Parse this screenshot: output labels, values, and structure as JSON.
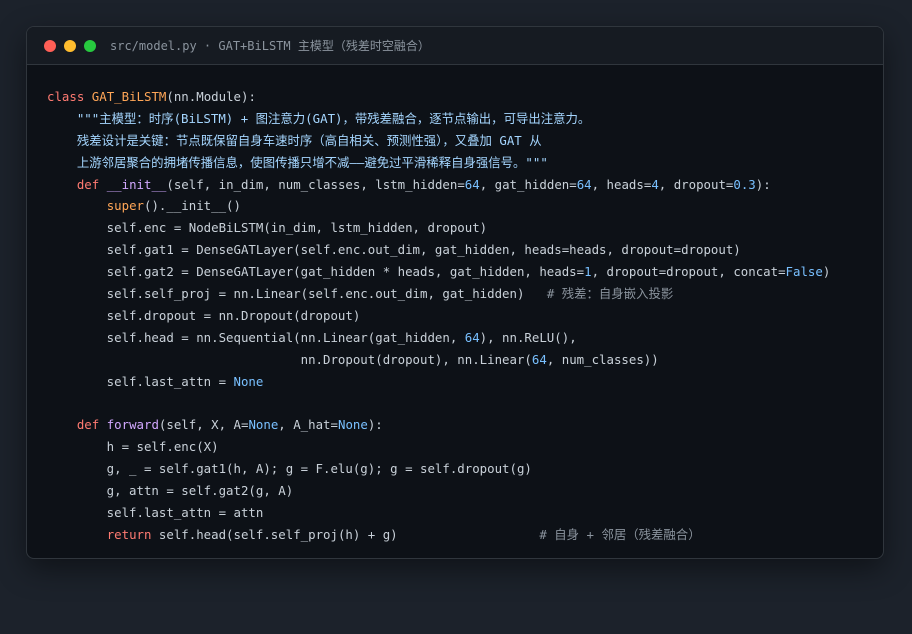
{
  "window": {
    "title": "src/model.py · GAT+BiLSTM 主模型（残差时空融合）",
    "controls": {
      "close": "#ff5f56",
      "minimize": "#ffbd2e",
      "maximize": "#27c93f"
    }
  },
  "colors": {
    "background": "#1c222b",
    "editor": "#0d1117",
    "keyword": "#ff7b72",
    "class_name": "#ffa657",
    "function": "#d2a8ff",
    "string": "#a5d6ff",
    "number": "#79c0ff",
    "comment": "#8b949e"
  },
  "code": {
    "lines": [
      [
        {
          "t": "class",
          "c": "kw"
        },
        {
          "t": " "
        },
        {
          "t": "GAT_BiLSTM",
          "c": "cls"
        },
        {
          "t": "(nn.Module):"
        }
      ],
      [
        {
          "t": "    "
        },
        {
          "t": "\"\"\"主模型：时序(BiLSTM) + 图注意力(GAT)，带残差融合，逐节点输出，可导出注意力。",
          "c": "str"
        }
      ],
      [
        {
          "t": "    残差设计是关键：节点既保留自身车速时序（高自相关、预测性强），又叠加 GAT 从",
          "c": "str"
        }
      ],
      [
        {
          "t": "    上游邻居聚合的拥堵传播信息，使图传播只增不减——避免过平滑稀释自身强信号。\"\"\"",
          "c": "str"
        }
      ],
      [
        {
          "t": "    "
        },
        {
          "t": "def",
          "c": "kw"
        },
        {
          "t": " "
        },
        {
          "t": "__init__",
          "c": "fn"
        },
        {
          "t": "(self, in_dim, num_classes, lstm_hidden="
        },
        {
          "t": "64",
          "c": "num"
        },
        {
          "t": ", gat_hidden="
        },
        {
          "t": "64",
          "c": "num"
        },
        {
          "t": ", heads="
        },
        {
          "t": "4",
          "c": "num"
        },
        {
          "t": ", dropout="
        },
        {
          "t": "0.3",
          "c": "num"
        },
        {
          "t": "):"
        }
      ],
      [
        {
          "t": "        "
        },
        {
          "t": "super",
          "c": "cls"
        },
        {
          "t": "().__init__()"
        }
      ],
      [
        {
          "t": "        self.enc = NodeBiLSTM(in_dim, lstm_hidden, dropout)"
        }
      ],
      [
        {
          "t": "        self.gat1 = DenseGATLayer(self.enc.out_dim, gat_hidden, heads=heads, dropout=dropout)"
        }
      ],
      [
        {
          "t": "        self.gat2 = DenseGATLayer(gat_hidden * heads, gat_hidden, heads="
        },
        {
          "t": "1",
          "c": "num"
        },
        {
          "t": ", dropout=dropout, concat="
        },
        {
          "t": "False",
          "c": "cst"
        },
        {
          "t": ")"
        }
      ],
      [
        {
          "t": "        self.self_proj = nn.Linear(self.enc.out_dim, gat_hidden)   "
        },
        {
          "t": "# 残差：自身嵌入投影",
          "c": "cmt"
        }
      ],
      [
        {
          "t": "        self.dropout = nn.Dropout(dropout)"
        }
      ],
      [
        {
          "t": "        self.head = nn.Sequential(nn.Linear(gat_hidden, "
        },
        {
          "t": "64",
          "c": "num"
        },
        {
          "t": "), nn.ReLU(),"
        }
      ],
      [
        {
          "t": "                                  nn.Dropout(dropout), nn.Linear("
        },
        {
          "t": "64",
          "c": "num"
        },
        {
          "t": ", num_classes))"
        }
      ],
      [
        {
          "t": "        self.last_attn = "
        },
        {
          "t": "None",
          "c": "cst"
        }
      ],
      [],
      [
        {
          "t": "    "
        },
        {
          "t": "def",
          "c": "kw"
        },
        {
          "t": " "
        },
        {
          "t": "forward",
          "c": "fn"
        },
        {
          "t": "(self, X, A="
        },
        {
          "t": "None",
          "c": "cst"
        },
        {
          "t": ", A_hat="
        },
        {
          "t": "None",
          "c": "cst"
        },
        {
          "t": "):"
        }
      ],
      [
        {
          "t": "        h = self.enc(X)"
        }
      ],
      [
        {
          "t": "        g, _ = self.gat1(h, A); g = F.elu(g); g = self.dropout(g)"
        }
      ],
      [
        {
          "t": "        g, attn = self.gat2(g, A)"
        }
      ],
      [
        {
          "t": "        self.last_attn = attn"
        }
      ],
      [
        {
          "t": "        "
        },
        {
          "t": "return",
          "c": "kw"
        },
        {
          "t": " self.head(self.self_proj(h) + g)                   "
        },
        {
          "t": "# 自身 + 邻居（残差融合）",
          "c": "cmt"
        }
      ]
    ]
  }
}
